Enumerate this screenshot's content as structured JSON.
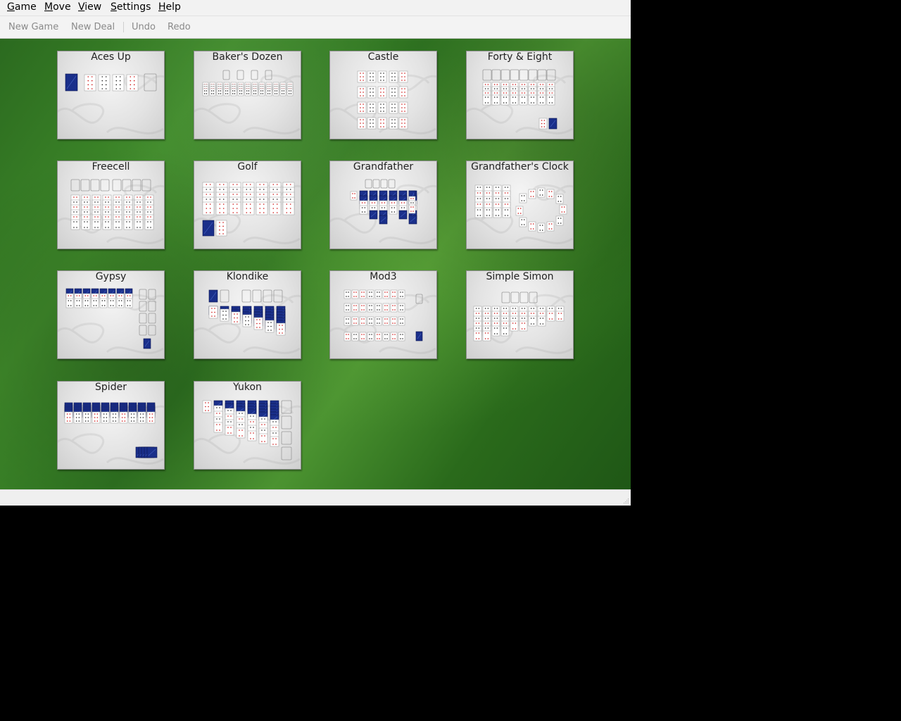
{
  "menu": [
    {
      "label": "Game",
      "mnemonic": "G",
      "rest": "ame"
    },
    {
      "label": "Move",
      "mnemonic": "M",
      "rest": "ove"
    },
    {
      "label": "View",
      "mnemonic": "V",
      "rest": "iew"
    },
    {
      "label": "Settings",
      "mnemonic": "S",
      "rest": "ettings"
    },
    {
      "label": "Help",
      "mnemonic": "H",
      "rest": "elp"
    }
  ],
  "toolbar": {
    "new_game": "New Game",
    "new_deal": "New Deal",
    "undo": "Undo",
    "redo": "Redo"
  },
  "games": [
    "Aces Up",
    "Baker's Dozen",
    "Castle",
    "Forty & Eight",
    "Freecell",
    "Golf",
    "Grandfather",
    "Grandfather's Clock",
    "Gypsy",
    "Klondike",
    "Mod3",
    "Simple Simon",
    "Spider",
    "Yukon"
  ],
  "colors": {
    "felt": "#3f8a2a",
    "card_back": "#1a2f8a",
    "red_suit": "#cc1111",
    "black_suit": "#222222"
  },
  "icons": {
    "resize_grip": "resize-grip-icon"
  }
}
